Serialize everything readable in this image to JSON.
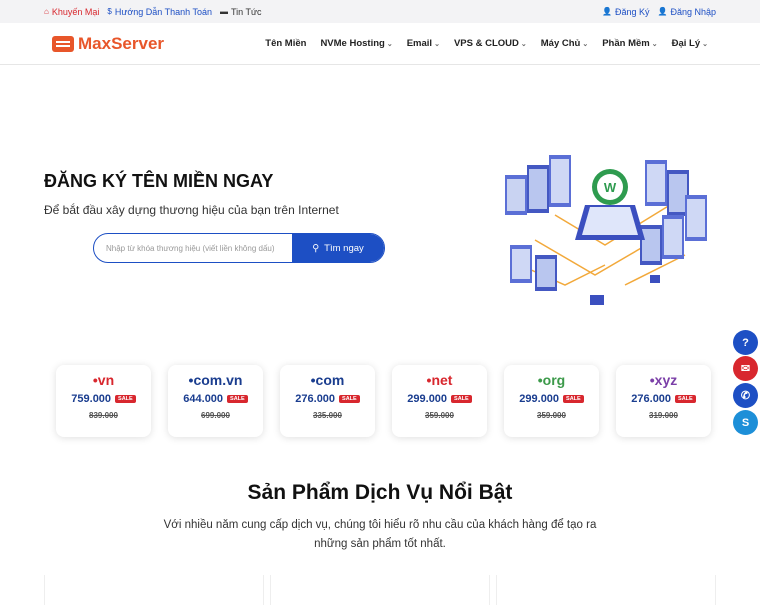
{
  "topbar": {
    "promo": "Khuyến Mại",
    "guide": "Hướng Dẫn Thanh Toán",
    "news": "Tin Tức",
    "register": "Đăng Ký",
    "login": "Đăng Nhập"
  },
  "brand": {
    "logo_prefix": "Max",
    "logo_suffix": "Server",
    "color": "#e8562a"
  },
  "nav": [
    {
      "label": "Tên Miền",
      "dropdown": false
    },
    {
      "label": "NVMe Hosting",
      "dropdown": true
    },
    {
      "label": "Email",
      "dropdown": true
    },
    {
      "label": "VPS & CLOUD",
      "dropdown": true
    },
    {
      "label": "Máy Chủ",
      "dropdown": true
    },
    {
      "label": "Phần Mềm",
      "dropdown": true
    },
    {
      "label": "Đại Lý",
      "dropdown": true
    }
  ],
  "hero": {
    "title": "ĐĂNG KÝ TÊN MIỀN NGAY",
    "subtitle": "Để bắt đầu xây dựng thương hiệu của bạn trên Internet",
    "search_placeholder": "Nhập từ khóa thương hiệu (viết liền không dấu)",
    "search_button": "Tìm ngay"
  },
  "domains": [
    {
      "ext": "vn",
      "price": "759.000",
      "sale": "SALE",
      "old": "839.000",
      "color": "#d8272e"
    },
    {
      "ext": "com.vn",
      "price": "644.000",
      "sale": "SALE",
      "old": "699.000",
      "color": "#1a3d8f"
    },
    {
      "ext": "com",
      "price": "276.000",
      "sale": "SALE",
      "old": "335.000",
      "color": "#1a3d8f"
    },
    {
      "ext": "net",
      "price": "299.000",
      "sale": "SALE",
      "old": "359.000",
      "color": "#d8272e"
    },
    {
      "ext": "org",
      "price": "299.000",
      "sale": "SALE",
      "old": "359.000",
      "color": "#3c9a4a"
    },
    {
      "ext": "xyz",
      "price": "276.000",
      "sale": "SALE",
      "old": "319.000",
      "color": "#7b3fa8"
    }
  ],
  "section": {
    "title": "Sản Phẩm Dịch Vụ Nổi Bật",
    "description": "Với nhiều năm cung cấp dịch vụ, chúng tôi hiểu rõ nhu cầu của khách hàng để tạo ra những sản phẩm tốt nhất."
  },
  "floating": [
    {
      "icon": "question-icon",
      "color": "#1d4fc4"
    },
    {
      "icon": "email-icon",
      "color": "#d8272e"
    },
    {
      "icon": "phone-icon",
      "color": "#1d4fc4"
    },
    {
      "icon": "skype-icon",
      "color": "#1d8fd8"
    }
  ]
}
